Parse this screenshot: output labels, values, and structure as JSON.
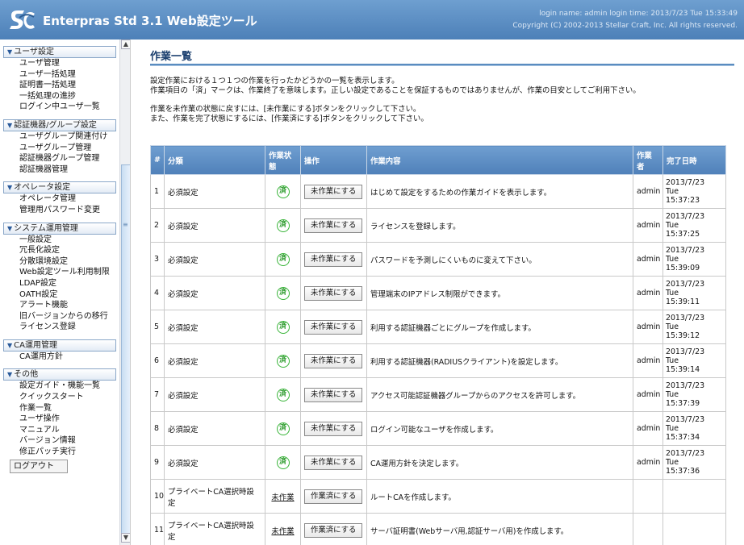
{
  "header": {
    "title": "Enterpras Std 3.1 Web設定ツール",
    "login_info": "login name: admin login time: 2013/7/23 Tue 15:33:49",
    "copyright": "Copyright (C) 2002-2013 Stellar Craft, Inc. All rights reserved."
  },
  "sidebar": {
    "sections": [
      {
        "title": "ユーザ設定",
        "items": [
          "ユーザ管理",
          "ユーザ一括処理",
          "証明書一括処理",
          "一括処理の進捗",
          "ログイン中ユーザ一覧"
        ]
      },
      {
        "title": "認証機器/グループ設定",
        "items": [
          "ユーザグループ関連付け",
          "ユーザグループ管理",
          "認証機器グループ管理",
          "認証機器管理"
        ]
      },
      {
        "title": "オペレータ設定",
        "items": [
          "オペレータ管理",
          "管理用パスワード変更"
        ]
      },
      {
        "title": "システム運用管理",
        "items": [
          "一般設定",
          "冗長化設定",
          "分散環境設定",
          "Web設定ツール利用制限",
          "LDAP設定",
          "OATH設定",
          "アラート機能",
          "旧バージョンからの移行",
          "ライセンス登録"
        ]
      },
      {
        "title": "CA運用管理",
        "items": [
          "CA運用方針"
        ]
      },
      {
        "title": "その他",
        "items": [
          "設定ガイド・機能一覧",
          "クイックスタート",
          "作業一覧",
          "ユーザ操作",
          "マニュアル",
          "バージョン情報",
          "修正パッチ実行"
        ]
      }
    ],
    "logout_label": "ログアウト"
  },
  "main": {
    "title": "作業一覧",
    "desc_lines": [
      "設定作業における１つ１つの作業を行ったかどうかの一覧を表示します。",
      "作業項目の「済」マークは、作業終了を意味します。正しい設定であることを保証するものではありませんが、作業の目安としてご利用下さい。",
      "作業を未作業の状態に戻すには、[未作業にする]ボタンをクリックして下さい。",
      "また、作業を完了状態にするには、[作業済にする]ボタンをクリックして下さい。"
    ],
    "columns": [
      "#",
      "分類",
      "作業状態",
      "操作",
      "作業内容",
      "作業者",
      "完了日時"
    ],
    "rows": [
      {
        "no": "1",
        "category": "必須設定",
        "status": "済",
        "op": "未作業にする",
        "content": "はじめて設定をするための作業ガイドを表示します。",
        "worker": "admin",
        "date": "2013/7/23",
        "day": "Tue",
        "time": "15:37:23"
      },
      {
        "no": "2",
        "category": "必須設定",
        "status": "済",
        "op": "未作業にする",
        "content": "ライセンスを登録します。",
        "worker": "admin",
        "date": "2013/7/23",
        "day": "Tue",
        "time": "15:37:25"
      },
      {
        "no": "3",
        "category": "必須設定",
        "status": "済",
        "op": "未作業にする",
        "content": "パスワードを予測しにくいものに変えて下さい。",
        "worker": "admin",
        "date": "2013/7/23",
        "day": "Tue",
        "time": "15:39:09"
      },
      {
        "no": "4",
        "category": "必須設定",
        "status": "済",
        "op": "未作業にする",
        "content": "管理端末のIPアドレス制限ができます。",
        "worker": "admin",
        "date": "2013/7/23",
        "day": "Tue",
        "time": "15:39:11"
      },
      {
        "no": "5",
        "category": "必須設定",
        "status": "済",
        "op": "未作業にする",
        "content": "利用する認証機器ごとにグループを作成します。",
        "worker": "admin",
        "date": "2013/7/23",
        "day": "Tue",
        "time": "15:39:12"
      },
      {
        "no": "6",
        "category": "必須設定",
        "status": "済",
        "op": "未作業にする",
        "content": "利用する認証機器(RADIUSクライアント)を設定します。",
        "worker": "admin",
        "date": "2013/7/23",
        "day": "Tue",
        "time": "15:39:14"
      },
      {
        "no": "7",
        "category": "必須設定",
        "status": "済",
        "op": "未作業にする",
        "content": "アクセス可能認証機器グループからのアクセスを許可します。",
        "worker": "admin",
        "date": "2013/7/23",
        "day": "Tue",
        "time": "15:37:39"
      },
      {
        "no": "8",
        "category": "必須設定",
        "status": "済",
        "op": "未作業にする",
        "content": "ログイン可能なユーザを作成します。",
        "worker": "admin",
        "date": "2013/7/23",
        "day": "Tue",
        "time": "15:37:34"
      },
      {
        "no": "9",
        "category": "必須設定",
        "status": "済",
        "op": "未作業にする",
        "content": "CA運用方針を決定します。",
        "worker": "admin",
        "date": "2013/7/23",
        "day": "Tue",
        "time": "15:37:36"
      },
      {
        "no": "10",
        "category": "プライベートCA選択時設定",
        "status": "未作業",
        "op": "作業済にする",
        "content": "ルートCAを作成します。",
        "worker": "",
        "date": "",
        "day": "",
        "time": ""
      },
      {
        "no": "11",
        "category": "プライベートCA選択時設定",
        "status": "未作業",
        "op": "作業済にする",
        "content": "サーバ証明書(Webサーバ用,認証サーバ用)を作成します。",
        "worker": "",
        "date": "",
        "day": "",
        "time": ""
      }
    ]
  },
  "colors": {
    "header_blue": "#5a8cc4",
    "done_green": "#3ab53a"
  },
  "icons": {
    "logo": "sc-logo-icon",
    "section": "triangle-down-icon"
  }
}
